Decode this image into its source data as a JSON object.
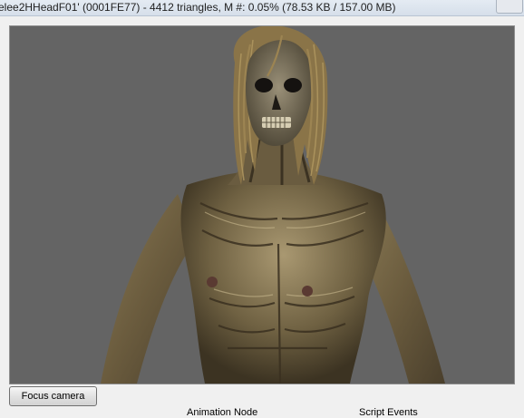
{
  "window": {
    "title": "elee2HHeadF01' (0001FE77) - 4412 triangles, M #: 0.05% (78.53 KB / 157.00 MB)"
  },
  "viewport": {
    "background_color": "#646464",
    "model": "zombie-torso-mesh"
  },
  "controls": {
    "focus_label": "Focus camera",
    "bottom_label_1": "Animation Node",
    "bottom_label_2": "Script Events"
  }
}
